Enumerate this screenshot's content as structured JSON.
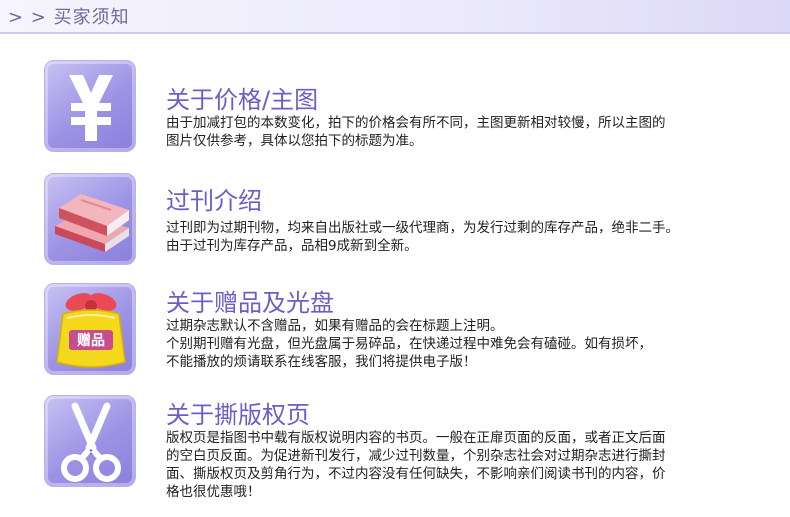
{
  "header": {
    "title": "> > 买家须知"
  },
  "sections": [
    {
      "icon": "yen-icon",
      "title": "关于价格/主图",
      "lines": [
        "由于加减打包的本数变化，拍下的价格会有所不同，主图更新相对较慢，所以主图的",
        "图片仅供参考，具体以您拍下的标题为准。"
      ]
    },
    {
      "icon": "books-icon",
      "title": "过刊介绍",
      "lines": [
        "过刊即为过期刊物，均来自出版社或一级代理商，为发行过剩的库存产品，绝非二手。",
        "由于过刊为库存产品，品相9成新到全新。"
      ]
    },
    {
      "icon": "gift-icon",
      "icon_label": "赠品",
      "title": "关于赠品及光盘",
      "lines": [
        "过期杂志默认不含赠品，如果有赠品的会在标题上注明。",
        "个别期刊赠有光盘，但光盘属于易碎品，在快递过程中难免会有磕碰。如有损坏，",
        "不能播放的烦请联系在线客服，我们将提供电子版！"
      ]
    },
    {
      "icon": "scissors-icon",
      "title": "关于撕版权页",
      "lines": [
        "版权页是指图书中载有版权说明内容的书页。一般在正扉页面的反面，或者正文后面",
        "的空白页反面。为促进新刊发行，减少过刊数量，个别杂志社会对过期杂志进行撕封",
        "面、撕版权页及剪角行为，不过内容没有任何缺失，不影响亲们阅读书刊的内容，价",
        "格也很优惠哦！"
      ]
    }
  ],
  "colors": {
    "accent": "#6a5fc7",
    "header_text": "#6e6a9e",
    "icon_bg": "#9c93e5",
    "body_text": "#222222"
  }
}
